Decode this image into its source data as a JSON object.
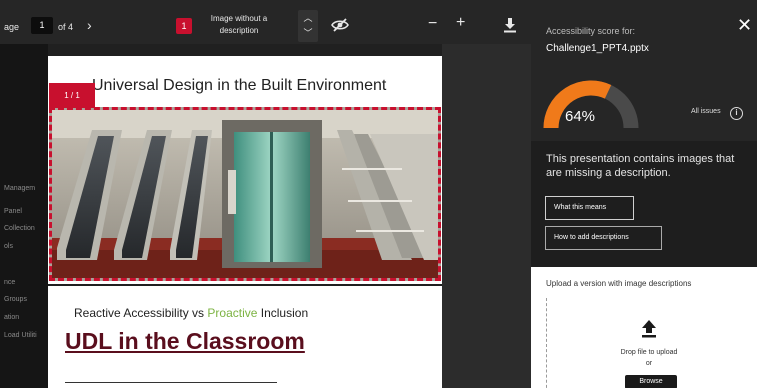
{
  "toolbar": {
    "page_label": "age",
    "current_page": "1",
    "page_of": "of 4",
    "next_icon": "chevron-right-icon",
    "issue_count": "1",
    "issue_text": "Image without a description",
    "prev_issue_icon": "chevron-up-icon",
    "next_issue_icon": "chevron-down-icon",
    "visibility_icon": "eye-slash-icon",
    "zoom_out": "−",
    "zoom_in": "+",
    "download_icon": "download-icon"
  },
  "sidebar": {
    "items": [
      "Managem",
      "Panel",
      "Collection",
      "ols",
      "nce",
      "Groups",
      "ation",
      "Load Utiliti"
    ]
  },
  "slides": {
    "slide1": {
      "title": "Universal Design in the Built Environment",
      "tag": "1 / 1",
      "image": "escalators-and-elevator-photo"
    },
    "slide2": {
      "subtitle_before": "Reactive Accessibility vs ",
      "subtitle_highlight": "Proactive",
      "subtitle_after": " Inclusion",
      "heading": "UDL in the Classroom"
    }
  },
  "panel": {
    "score_title": "Accessibility score for:",
    "filename": "Challenge1_PPT4.pptx",
    "score_value": "64%",
    "score_percent": 64,
    "all_issues": "All issues",
    "message": "This presentation contains images that are missing a description.",
    "what_button": "What this means",
    "how_button": "How to add descriptions",
    "upload_title": "Upload a version with image descriptions",
    "drop_text_line1": "Drop file to upload",
    "drop_text_line2": "or",
    "browse_button": "Browse",
    "colors": {
      "gauge_fill": "#f07a1a",
      "gauge_track": "#4a4a4a",
      "accent_red": "#c8102e",
      "green": "#7cb342"
    }
  }
}
